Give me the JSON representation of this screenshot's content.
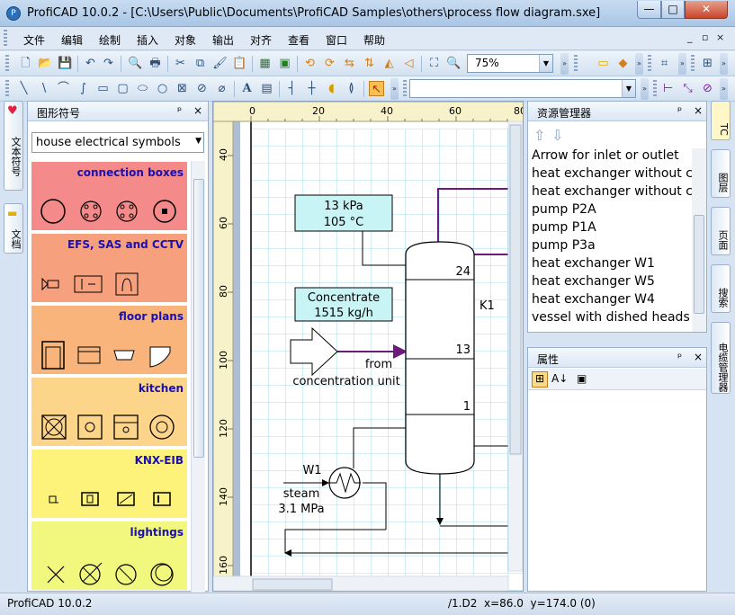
{
  "window": {
    "title": "ProfiCAD 10.0.2 - [C:\\Users\\Public\\Documents\\ProfiCAD Samples\\others\\process flow diagram.sxe]",
    "minimize": "—",
    "maximize": "□",
    "close": "✕"
  },
  "menu": {
    "items": [
      "文件",
      "编辑",
      "绘制",
      "插入",
      "对象",
      "输出",
      "对齐",
      "查看",
      "窗口",
      "帮助"
    ],
    "mdi_min": "_",
    "mdi_restore": "▫",
    "mdi_close": "×"
  },
  "toolbar": {
    "zoom_value": "75%",
    "text_label": "A"
  },
  "left_tabs": [
    "文本符号",
    "文档"
  ],
  "symbols_panel": {
    "title": "图形符号",
    "pin": "ᵖ",
    "close": "×",
    "library": "house electrical symbols",
    "categories": [
      {
        "title": "connection boxes",
        "color": "#f58a8a"
      },
      {
        "title": "EFS, SAS and CCTV",
        "color": "#f7a07e"
      },
      {
        "title": "floor plans",
        "color": "#f8b47a"
      },
      {
        "title": "kitchen",
        "color": "#fcd58a"
      },
      {
        "title": "KNX-EIB",
        "color": "#fdf37a"
      },
      {
        "title": "lightings",
        "color": "#f2f77e"
      }
    ]
  },
  "canvas": {
    "ruler_top": [
      "0",
      "20",
      "40",
      "60",
      "80"
    ],
    "ruler_left": [
      "40",
      "60",
      "80",
      "100",
      "120",
      "140",
      "160"
    ],
    "box1_line1": "13 kPa",
    "box1_line2": "105 °C",
    "box2_line1": "Concentrate",
    "box2_line2": "1515 kg/h",
    "from_label": "from",
    "from_label2": "concentration unit",
    "tray_24": "24",
    "tray_13": "13",
    "tray_1": "1",
    "column_tag": "K1",
    "hx_tag": "W1",
    "steam_label": "steam",
    "steam_pressure": "3.1 MPa"
  },
  "explorer": {
    "title": "资源管理器",
    "items": [
      "Arrow for inlet or outlet",
      "heat exchanger without c",
      "heat exchanger without c",
      "pump P2A",
      "pump P1A",
      "pump P3a",
      "heat exchanger W1",
      "heat exchanger W5",
      "heat exchanger W4",
      "vessel with dished heads"
    ]
  },
  "properties": {
    "title": "属性"
  },
  "right_tabs": [
    "TC",
    "图层",
    "页面",
    "搜索",
    "电缆管理器"
  ],
  "status": {
    "left": "ProfiCAD 10.0.2",
    "page": "/1.D2",
    "x": "x=86.0",
    "y": "y=174.0 (0)"
  },
  "colors": {
    "pipe": "#6d1b7b",
    "label_box": "#c9f4f6",
    "grid": "#8ad7e6"
  }
}
